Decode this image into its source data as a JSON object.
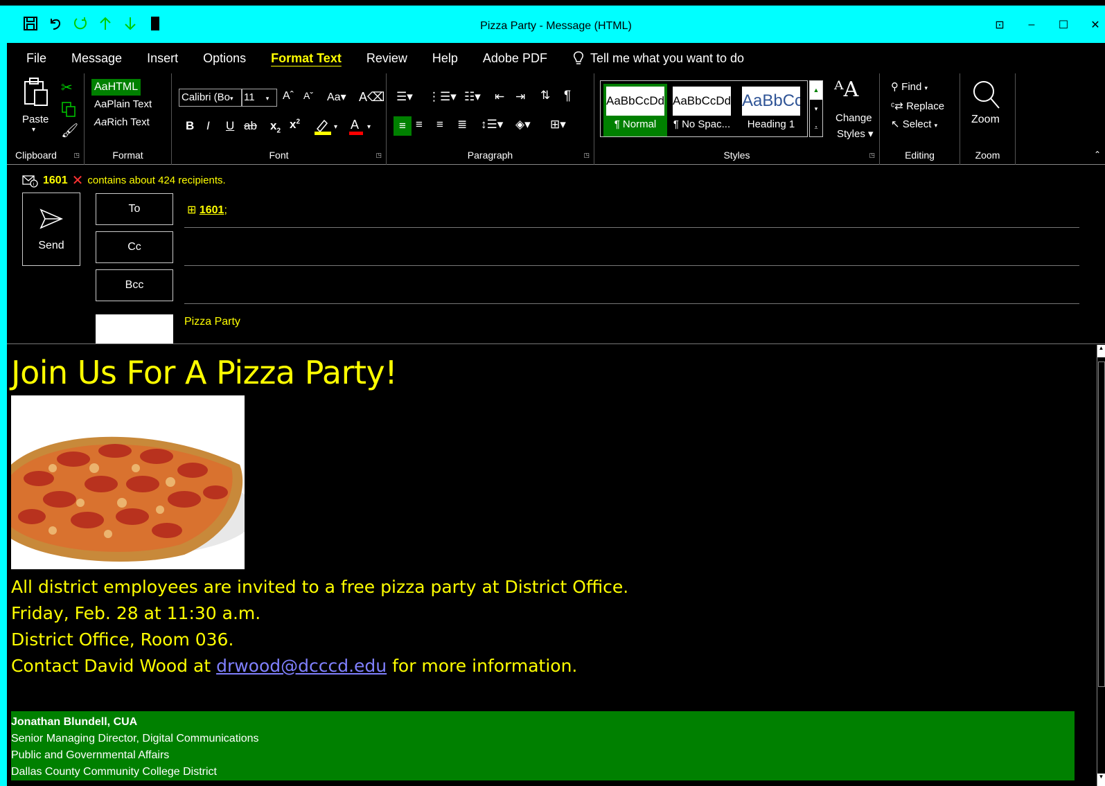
{
  "window": {
    "title": "Pizza Party  -  Message (HTML)",
    "controls": [
      "⊡",
      "–",
      "☐",
      "✕"
    ]
  },
  "quick_access": {
    "save_icon": "floppy-icon",
    "undo_icon": "undo-icon",
    "redo_icon": "redo-icon",
    "up_icon": "up-arrow-icon",
    "down_icon": "down-arrow-icon",
    "customize_icon": "block-icon"
  },
  "menu": {
    "tabs": [
      "File",
      "Message",
      "Insert",
      "Options",
      "Format Text",
      "Review",
      "Help",
      "Adobe PDF"
    ],
    "active": "Format Text",
    "tell_me": "Tell me what you want to do"
  },
  "ribbon": {
    "clipboard": {
      "label": "Clipboard",
      "paste": "Paste"
    },
    "format": {
      "label": "Format",
      "html": "HTML",
      "plain": "Plain Text",
      "rich": "Rich Text"
    },
    "font": {
      "label": "Font",
      "family": "Calibri (Bo",
      "size": "11"
    },
    "paragraph": {
      "label": "Paragraph"
    },
    "styles": {
      "label": "Styles",
      "items": [
        {
          "sample": "AaBbCcDd",
          "name": "¶ Normal"
        },
        {
          "sample": "AaBbCcDd",
          "name": "¶ No Spac..."
        },
        {
          "sample": "AaBbCc",
          "name": "Heading 1"
        }
      ],
      "change": "Change",
      "change2": "Styles"
    },
    "editing": {
      "label": "Editing",
      "find": "Find",
      "replace": "Replace",
      "select": "Select"
    },
    "zoom": {
      "label": "Zoom",
      "button": "Zoom"
    }
  },
  "compose": {
    "info_count": "1601",
    "info_text": "contains about 424 recipients.",
    "send": "Send",
    "to": "To",
    "cc": "Cc",
    "bcc": "Bcc",
    "recipient": "1601",
    "recipient_sep": ";",
    "subject": "Pizza Party"
  },
  "body": {
    "headline": "Join Us For A Pizza Party!",
    "line1": "All district employees are invited to a free pizza party at District Office.",
    "line2": "Friday, Feb. 28 at 11:30 a.m.",
    "line3": "District Office, Room 036.",
    "line4_pre": "Contact David Wood at ",
    "line4_link": "drwood@dcccd.edu",
    "line4_post": " for more information."
  },
  "signature": {
    "name": "Jonathan Blundell, CUA",
    "title": "Senior Managing Director, Digital Communications",
    "dept": "Public and Governmental Affairs",
    "org": "Dallas County Community College District"
  },
  "colors": {
    "accent": "#00ffff",
    "text_highlight": "#ffff00",
    "signature_bg": "#008000"
  }
}
